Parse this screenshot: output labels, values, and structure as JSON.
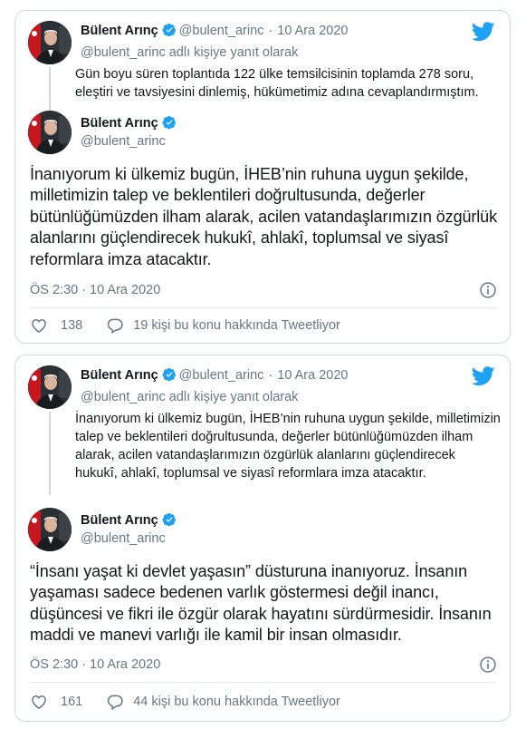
{
  "colors": {
    "twitter_blue": "#1da1f2",
    "text_primary": "#14171a",
    "text_secondary": "#657786",
    "border": "#cfd9de",
    "verified_blue": "#1da1f2"
  },
  "icons": {
    "logo": "twitter-bird-icon",
    "verified": "verified-badge-icon",
    "info": "info-icon",
    "like": "heart-icon",
    "reply": "speech-bubble-icon"
  },
  "tweets": [
    {
      "quoted": {
        "name": "Bülent Arınç",
        "handle": "@bulent_arinc",
        "dot": "·",
        "date": "10 Ara 2020",
        "reply_to": "@bulent_arinc adlı kişiye yanıt olarak",
        "text": "Gün boyu süren toplantıda 122 ülke temsilcisinin toplamda 278 soru, eleştiri ve tavsiyesini dinlemiş, hükümetimiz adına cevaplandırmıştım."
      },
      "author": {
        "name": "Bülent Arınç",
        "handle": "@bulent_arinc"
      },
      "text": "İnanıyorum ki ülkemiz bugün, İHEB’nin ruhuna uygun şekilde, milletimizin talep ve beklentileri doğrultusunda, değerler bütünlüğümüzden ilham alarak, acilen vatandaşlarımızın özgürlük alanlarını güçlendirecek hukukî, ahlakî, toplumsal ve siyasî reformlara imza atacaktır.",
      "time": "ÖS 2:30",
      "sep": "·",
      "date": "10 Ara 2020",
      "likes": "138",
      "replies_text": "19 kişi bu konu hakkında Tweetliyor"
    },
    {
      "quoted": {
        "name": "Bülent Arınç",
        "handle": "@bulent_arinc",
        "dot": "·",
        "date": "10 Ara 2020",
        "reply_to": "@bulent_arinc adlı kişiye yanıt olarak",
        "text": "İnanıyorum ki ülkemiz bugün, İHEB’nin ruhuna uygun şekilde, milletimizin talep ve beklentileri doğrultusunda, değerler bütünlüğümüzden ilham alarak, acilen vatandaşlarımızın özgürlük alanlarını güçlendirecek hukukî, ahlakî, toplumsal ve siyasî reformlara imza atacaktır."
      },
      "author": {
        "name": "Bülent Arınç",
        "handle": "@bulent_arinc"
      },
      "text": "“İnsanı yaşat ki devlet yaşasın” düsturuna inanıyoruz. İnsanın yaşaması sadece bedenen varlık göstermesi değil inancı, düşüncesi ve fikri ile özgür olarak hayatını sürdürmesidir. İnsanın maddi ve manevi varlığı ile kamil bir insan olmasıdır.",
      "time": "ÖS 2:30",
      "sep": "·",
      "date": "10 Ara 2020",
      "likes": "161",
      "replies_text": "44 kişi bu konu hakkında Tweetliyor"
    }
  ]
}
